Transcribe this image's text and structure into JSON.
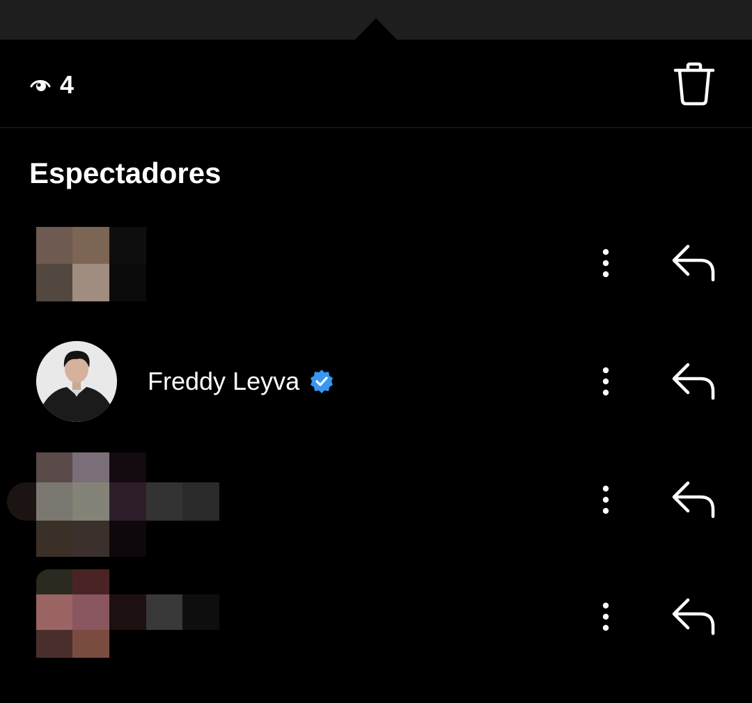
{
  "header": {
    "view_count": "4",
    "icons": {
      "views": "eye-icon",
      "delete": "trash-icon"
    }
  },
  "section": {
    "title": "Espectadores"
  },
  "viewers": [
    {
      "name": "",
      "verified": false,
      "avatar": "pixelated"
    },
    {
      "name": "Freddy Leyva",
      "verified": true,
      "avatar": "photo"
    },
    {
      "name": "",
      "verified": false,
      "avatar": "pixelated"
    },
    {
      "name": "",
      "verified": false,
      "avatar": "pixelated"
    }
  ],
  "colors": {
    "background": "#000000",
    "topbar": "#1e1e1e",
    "verified_badge": "#3897f0",
    "divider": "#262626"
  }
}
